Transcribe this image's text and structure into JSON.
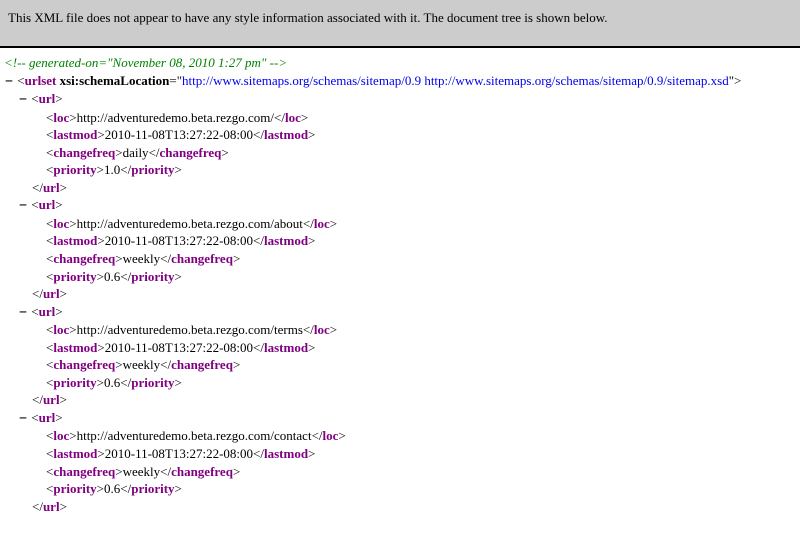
{
  "banner": "This XML file does not appear to have any style information associated with it. The document tree is shown below.",
  "comment": "<!-- generated-on=\"November 08, 2010 1:27 pm\" -->",
  "toggle": "−",
  "tags": {
    "urlset": "urlset",
    "url": "url",
    "loc": "loc",
    "lastmod": "lastmod",
    "changefreq": "changefreq",
    "priority": "priority"
  },
  "attr": {
    "name": "xsi:schemaLocation",
    "value": "http://www.sitemaps.org/schemas/sitemap/0.9 http://www.sitemaps.org/schemas/sitemap/0.9/sitemap.xsd"
  },
  "urls": [
    {
      "loc": "http://adventuredemo.beta.rezgo.com/",
      "lastmod": "2010-11-08T13:27:22-08:00",
      "changefreq": "daily",
      "priority": "1.0"
    },
    {
      "loc": "http://adventuredemo.beta.rezgo.com/about",
      "lastmod": "2010-11-08T13:27:22-08:00",
      "changefreq": "weekly",
      "priority": "0.6"
    },
    {
      "loc": "http://adventuredemo.beta.rezgo.com/terms",
      "lastmod": "2010-11-08T13:27:22-08:00",
      "changefreq": "weekly",
      "priority": "0.6"
    },
    {
      "loc": "http://adventuredemo.beta.rezgo.com/contact",
      "lastmod": "2010-11-08T13:27:22-08:00",
      "changefreq": "weekly",
      "priority": "0.6"
    }
  ]
}
